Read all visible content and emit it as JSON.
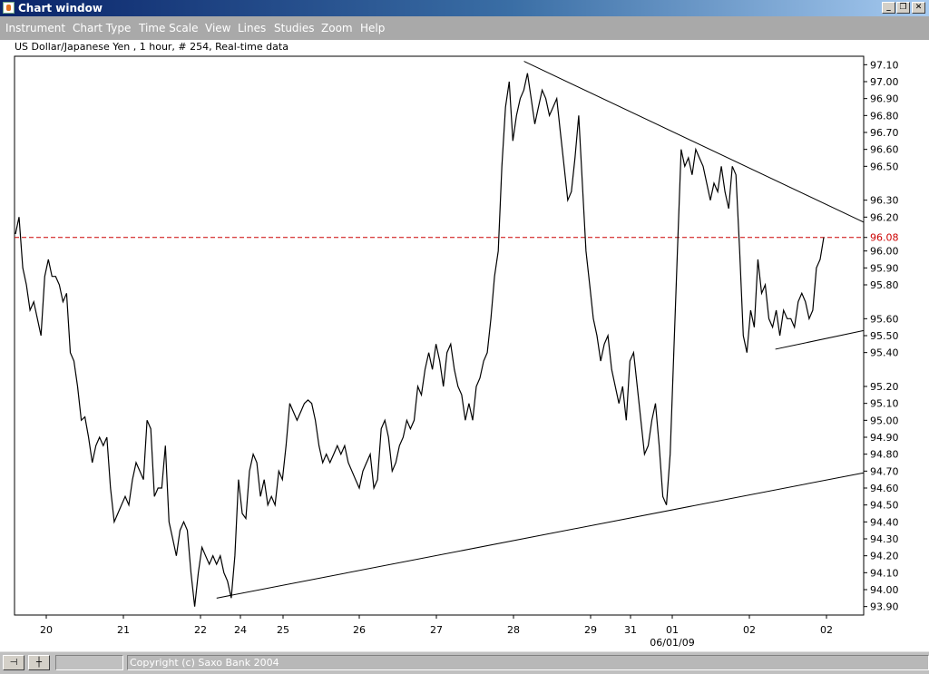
{
  "window": {
    "title": "Chart window",
    "icon": "java-cup-icon",
    "controls": {
      "minimize": "_",
      "restore": "❐",
      "close": "✕"
    }
  },
  "menu": [
    "Instrument",
    "Chart Type",
    "Time Scale",
    "View",
    "Lines",
    "Studies",
    "Zoom",
    "Help"
  ],
  "chart_caption": "US Dollar/Japanese Yen , 1 hour, # 254, Real-time data",
  "status": {
    "copyright": "Copyright (c) Saxo Bank 2004",
    "pin_icon": "pin-icon",
    "crosshair_icon": "crosshair-icon"
  },
  "chart_data": {
    "type": "line",
    "instrument": "US Dollar/Japanese Yen",
    "interval": "1 hour",
    "ylim": [
      93.85,
      97.15
    ],
    "y_ticks": [
      "97.10",
      "97.00",
      "96.90",
      "96.80",
      "96.70",
      "96.60",
      "96.50",
      "96.30",
      "96.20",
      "96.08",
      "96.00",
      "95.90",
      "95.80",
      "95.60",
      "95.50",
      "95.40",
      "95.20",
      "95.10",
      "95.00",
      "94.90",
      "94.80",
      "94.70",
      "94.60",
      "94.50",
      "94.40",
      "94.30",
      "94.20",
      "94.10",
      "94.00",
      "93.90"
    ],
    "x_ticks": [
      "20",
      "21",
      "22",
      "24",
      "25",
      "26",
      "27",
      "28",
      "29",
      "31",
      "01",
      "02",
      "02"
    ],
    "x_sublabel": "06/01/09",
    "current_price": 96.08,
    "current_price_label": "96.08",
    "colors": {
      "price_line": "#000000",
      "reference_line": "#cc0000",
      "trendline": "#000000"
    },
    "series": [
      {
        "values": [
          96.1,
          96.2,
          95.9,
          95.8,
          95.65,
          95.7,
          95.6,
          95.5,
          95.85,
          95.95,
          95.85,
          95.85,
          95.8,
          95.7,
          95.75,
          95.4,
          95.35,
          95.2,
          95.0,
          95.02,
          94.9,
          94.75,
          94.85,
          94.9,
          94.85,
          94.9,
          94.6,
          94.4,
          94.45,
          94.5,
          94.55,
          94.5,
          94.65,
          94.75,
          94.7,
          94.65,
          95.0,
          94.95,
          94.55,
          94.6,
          94.6,
          94.85,
          94.4,
          94.3,
          94.2,
          94.35,
          94.4,
          94.35,
          94.1,
          93.9,
          94.1,
          94.25,
          94.2,
          94.15,
          94.2,
          94.15,
          94.2,
          94.1,
          94.05,
          93.95,
          94.2,
          94.65,
          94.45,
          94.42,
          94.7,
          94.8,
          94.75,
          94.55,
          94.65,
          94.5,
          94.55,
          94.5,
          94.7,
          94.65,
          94.85,
          95.1,
          95.05,
          95.0,
          95.05,
          95.1,
          95.12,
          95.1,
          95.0,
          94.85,
          94.75,
          94.8,
          94.75,
          94.8,
          94.85,
          94.8,
          94.85,
          94.75,
          94.7,
          94.65,
          94.6,
          94.7,
          94.75,
          94.8,
          94.6,
          94.65,
          94.95,
          95.0,
          94.9,
          94.7,
          94.75,
          94.85,
          94.9,
          95.0,
          94.95,
          95.0,
          95.2,
          95.15,
          95.3,
          95.4,
          95.3,
          95.45,
          95.35,
          95.2,
          95.4,
          95.45,
          95.3,
          95.2,
          95.15,
          95.0,
          95.1,
          95.0,
          95.2,
          95.25,
          95.35,
          95.4,
          95.6,
          95.85,
          96.0,
          96.5,
          96.85,
          97.0,
          96.65,
          96.8,
          96.9,
          96.95,
          97.05,
          96.9,
          96.75,
          96.85,
          96.95,
          96.9,
          96.8,
          96.85,
          96.9,
          96.7,
          96.5,
          96.3,
          96.35,
          96.55,
          96.8,
          96.4,
          96.0,
          95.8,
          95.6,
          95.5,
          95.35,
          95.45,
          95.5,
          95.3,
          95.2,
          95.1,
          95.2,
          95.0,
          95.35,
          95.4,
          95.2,
          95.0,
          94.8,
          94.85,
          95.0,
          95.1,
          94.85,
          94.55,
          94.5,
          94.8,
          95.4,
          96.0,
          96.6,
          96.5,
          96.55,
          96.45,
          96.6,
          96.55,
          96.5,
          96.4,
          96.3,
          96.4,
          96.35,
          96.5,
          96.35,
          96.25,
          96.5,
          96.45,
          96.0,
          95.5,
          95.4,
          95.65,
          95.55,
          95.95,
          95.75,
          95.8,
          95.6,
          95.55,
          95.65,
          95.5,
          95.65,
          95.6,
          95.6,
          95.55,
          95.7,
          95.75,
          95.7,
          95.6,
          95.65,
          95.9,
          95.95,
          96.08
        ]
      }
    ],
    "trendlines": [
      {
        "name": "resistance",
        "from": [
          0.6,
          97.12
        ],
        "to": [
          1.0,
          96.17
        ]
      },
      {
        "name": "support-long",
        "from": [
          0.238,
          93.95
        ],
        "to": [
          1.0,
          94.69
        ]
      },
      {
        "name": "support-short",
        "from": [
          0.896,
          95.42
        ],
        "to": [
          1.0,
          95.53
        ]
      }
    ]
  }
}
